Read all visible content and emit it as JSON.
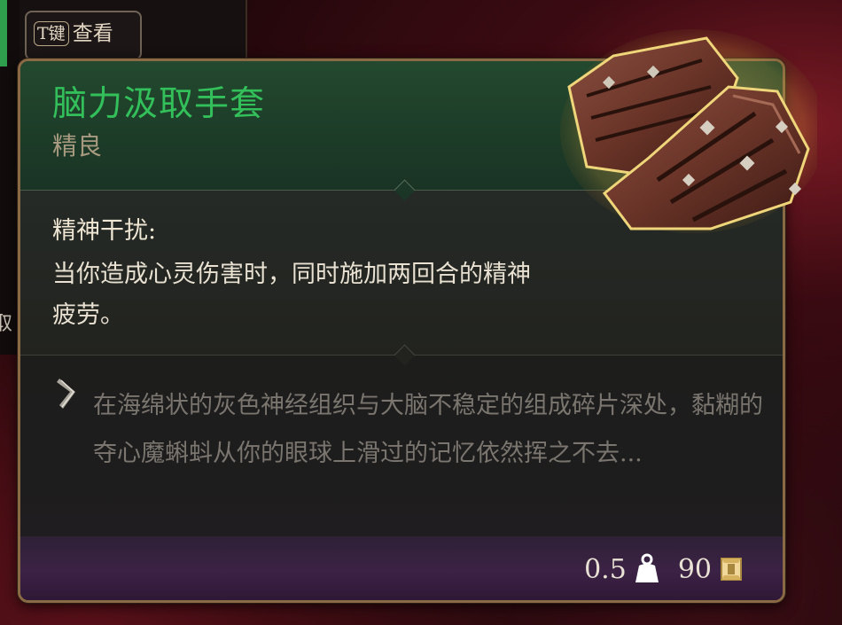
{
  "hud": {
    "hint_key": "T键",
    "hint_label": "查看",
    "left_edge_char": "取"
  },
  "tooltip": {
    "item_name": "脑力汲取手套",
    "rarity": "精良",
    "passive_title": "精神干扰:",
    "passive_desc": "当你造成心灵伤害时，同时施加两回合的精神疲劳。",
    "flavor_text": "在海绵状的灰色神经组织与大脑不稳定的组成碎片深处，黏糊的夺心魔蝌蚪从你的眼球上滑过的记忆依然挥之不去...",
    "weight": "0.5",
    "value": "90",
    "icons": {
      "flavor": "chevron-icon",
      "weight": "weight-icon",
      "gold": "gold-icon",
      "item": "gloves-icon"
    },
    "colors": {
      "rarity_uncommon": "#33c05b",
      "border": "#8a6a45",
      "footer": "#3c2245"
    }
  }
}
